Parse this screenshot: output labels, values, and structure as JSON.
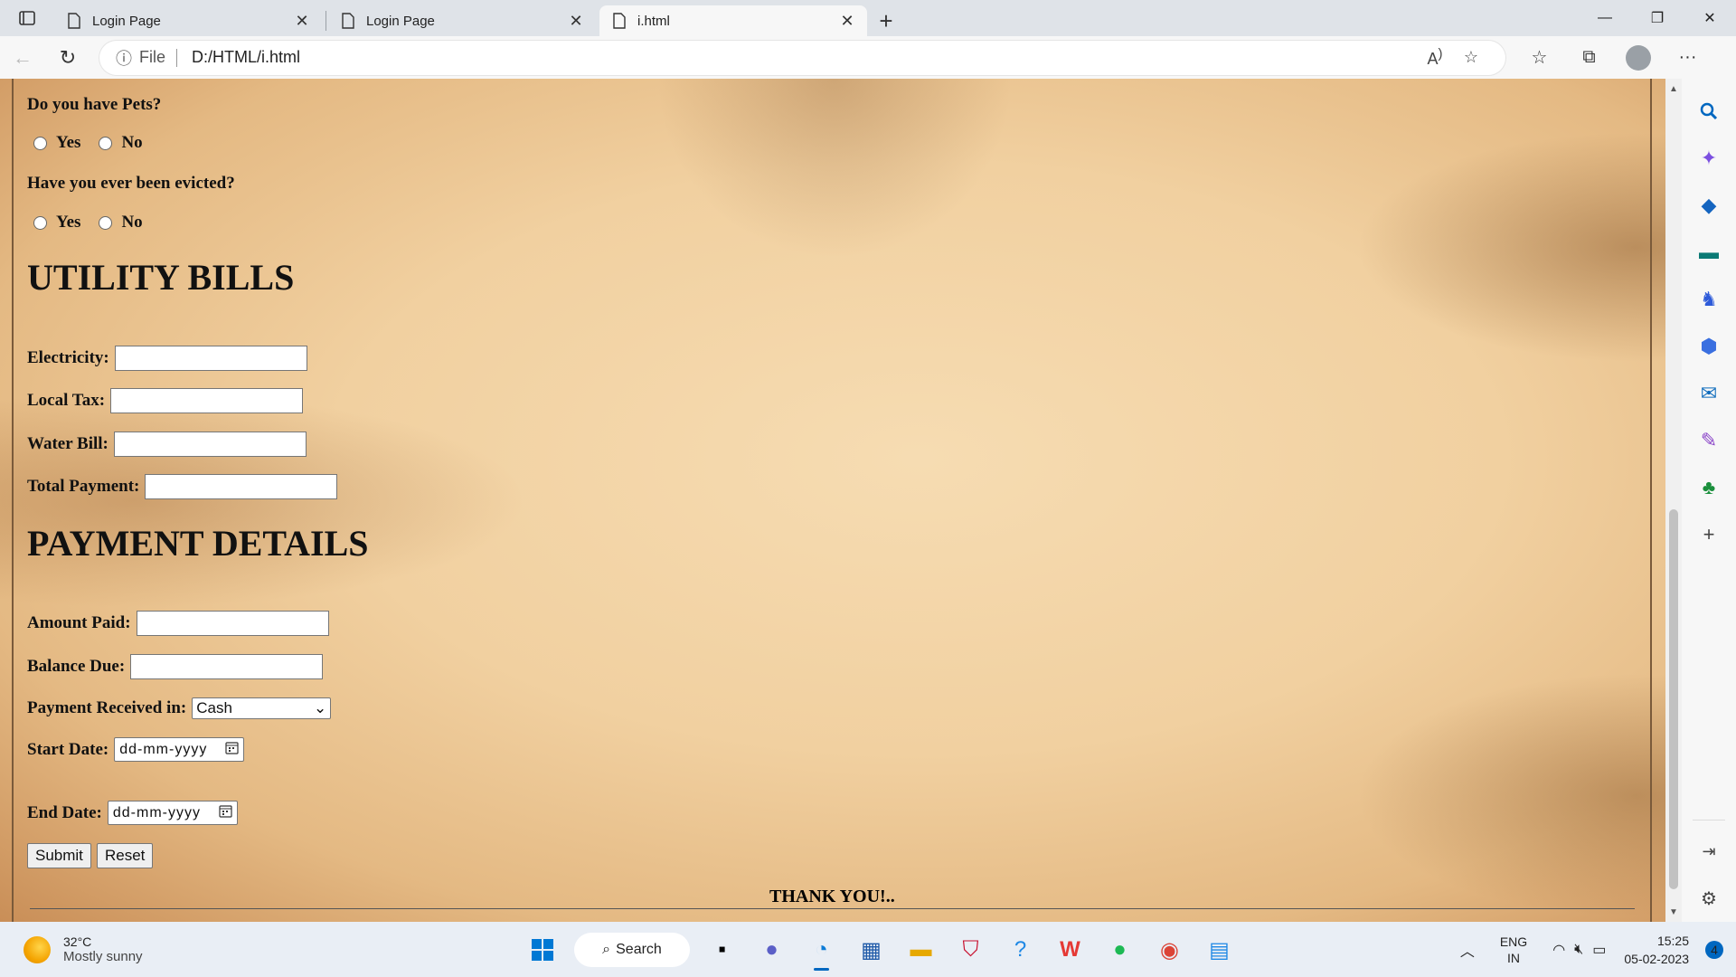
{
  "browser": {
    "tabs": [
      {
        "label": "Login Page",
        "active": false
      },
      {
        "label": "Login Page",
        "active": false
      },
      {
        "label": "i.html",
        "active": true
      }
    ],
    "address": {
      "info_label": "File",
      "url": "D:/HTML/i.html"
    }
  },
  "form": {
    "pets_question": "Do you have Pets?",
    "evicted_question": "Have you ever been evicted?",
    "yes_label": "Yes",
    "no_label": "No",
    "utility_heading": "UTILITY BILLS",
    "electricity_label": "Electricity:",
    "local_tax_label": "Local Tax:",
    "water_bill_label": "Water Bill:",
    "total_payment_label": "Total Payment:",
    "payment_heading": "PAYMENT DETAILS",
    "amount_paid_label": "Amount Paid:",
    "balance_due_label": "Balance Due:",
    "payment_received_label": "Payment Received in:",
    "payment_received_value": "Cash",
    "start_date_label": "Start Date:",
    "end_date_label": "End Date:",
    "date_placeholder": "dd-mm-yyyy",
    "submit_label": "Submit",
    "reset_label": "Reset",
    "thank_you": "THANK YOU!.."
  },
  "taskbar": {
    "weather_temp": "32°C",
    "weather_desc": "Mostly sunny",
    "search_label": "Search",
    "lang_line1": "ENG",
    "lang_line2": "IN",
    "time": "15:25",
    "date": "05-02-2023",
    "notifications": "4"
  }
}
